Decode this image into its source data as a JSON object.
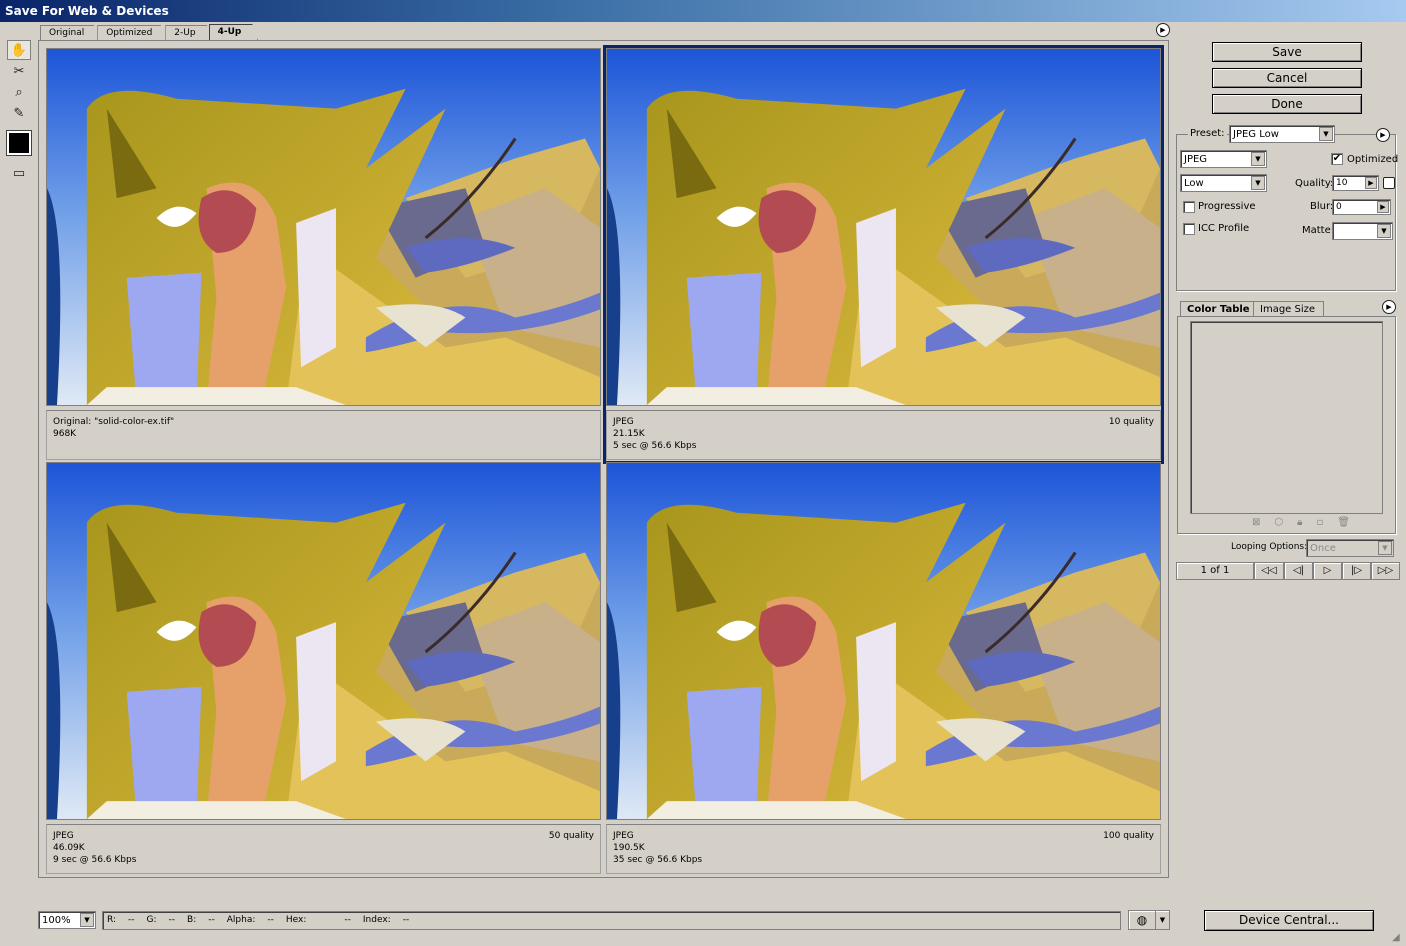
{
  "window": {
    "title": "Save For Web & Devices"
  },
  "tabs": [
    "Original",
    "Optimized",
    "2-Up",
    "4-Up"
  ],
  "active_tab": "4-Up",
  "tools": [
    {
      "name": "hand-tool-icon",
      "glyph": "✋"
    },
    {
      "name": "slice-select-tool-icon",
      "glyph": "✂"
    },
    {
      "name": "zoom-tool-icon",
      "glyph": "🔍"
    },
    {
      "name": "eyedropper-tool-icon",
      "glyph": "✎"
    }
  ],
  "panes": [
    {
      "line1": "Original: \"solid-color-ex.tif\"",
      "line2": "968K",
      "line3": "",
      "right": ""
    },
    {
      "line1": "JPEG",
      "line2": "21.15K",
      "line3": "5 sec @ 56.6 Kbps",
      "right": "10 quality"
    },
    {
      "line1": "JPEG",
      "line2": "46.09K",
      "line3": "9 sec @ 56.6 Kbps",
      "right": "50 quality"
    },
    {
      "line1": "JPEG",
      "line2": "190.5K",
      "line3": "35 sec @ 56.6 Kbps",
      "right": "100 quality"
    }
  ],
  "buttons": {
    "save": "Save",
    "cancel": "Cancel",
    "done": "Done",
    "device_central": "Device Central..."
  },
  "settings": {
    "preset_label": "Preset:",
    "preset_value": "JPEG Low",
    "format_value": "JPEG",
    "quality_level": "Low",
    "optimized_label": "Optimized",
    "optimized_checked": true,
    "progressive_label": "Progressive",
    "icc_label": "ICC Profile",
    "quality_label": "Quality:",
    "quality_value": "10",
    "blur_label": "Blur:",
    "blur_value": "0",
    "matte_label": "Matte:"
  },
  "color_table": {
    "tabs": [
      "Color Table",
      "Image Size"
    ],
    "looping_label": "Looping Options:",
    "looping_value": "Once",
    "frame_counter": "1 of 1"
  },
  "status": {
    "zoom": "100%",
    "fields": [
      "R:",
      "--",
      "G:",
      "--",
      "B:",
      "--",
      "Alpha:",
      "--",
      "Hex:",
      "--",
      "Index:",
      "--"
    ]
  },
  "colors": {
    "selection": "#0a246a",
    "sky_top": "#1c55d8",
    "gold": "#b8a22a"
  }
}
